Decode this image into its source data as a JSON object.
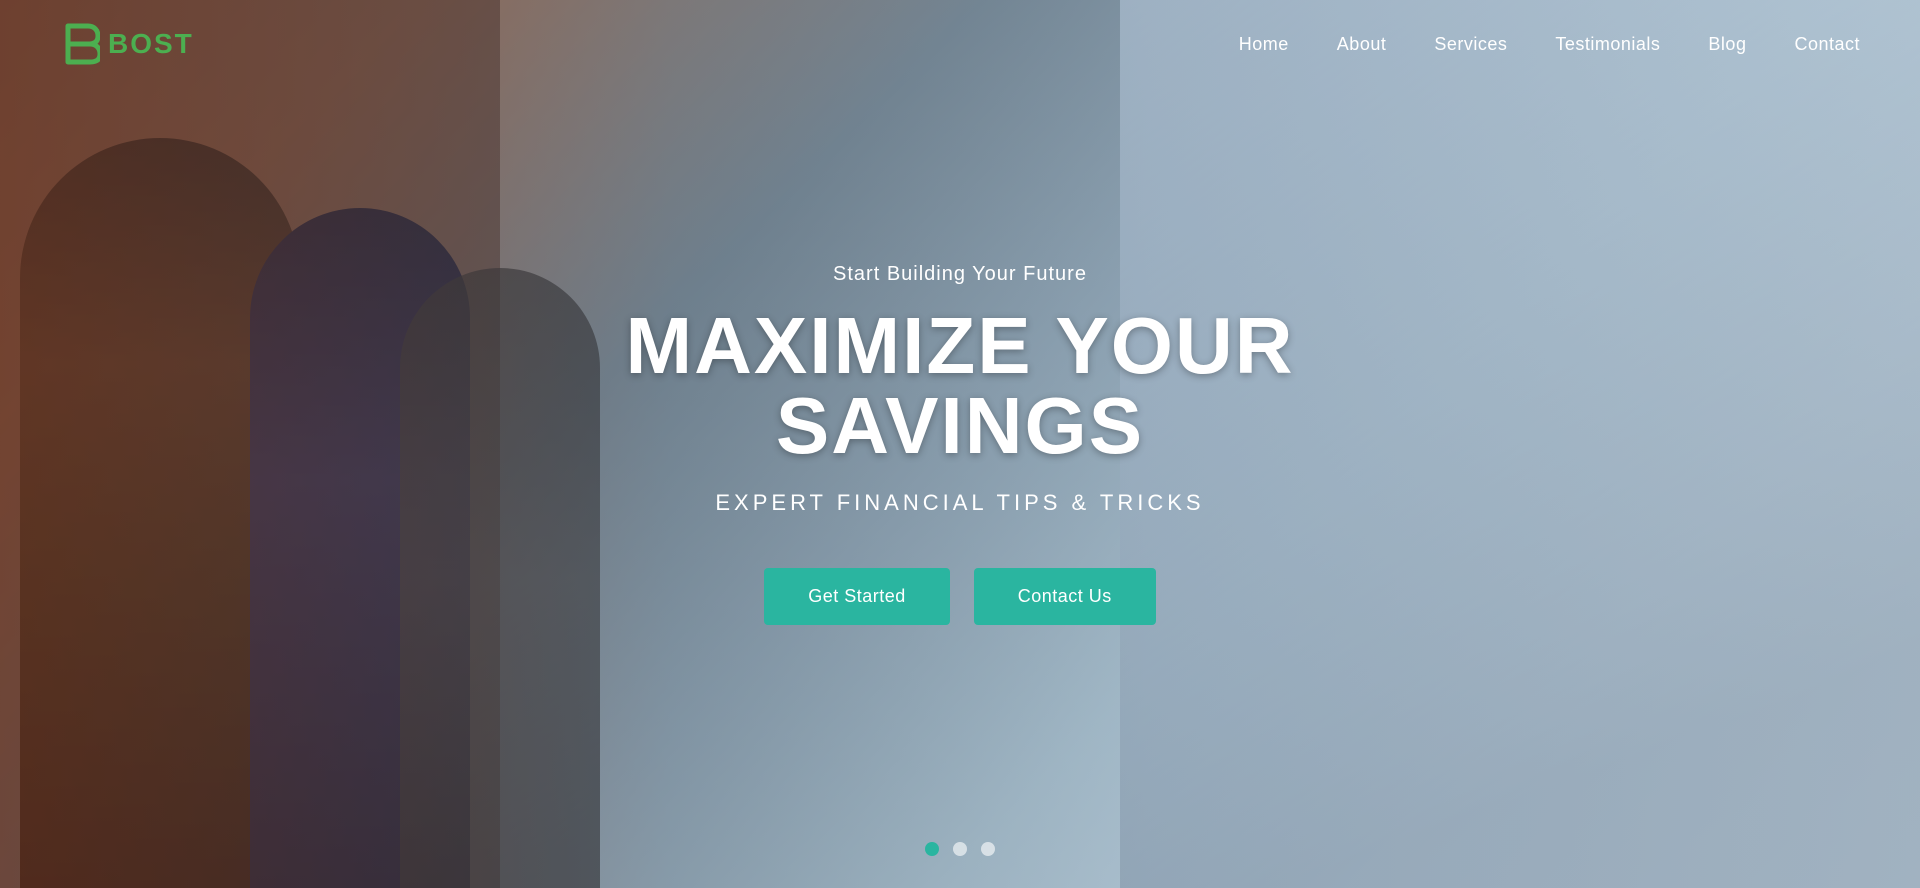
{
  "brand": {
    "name": "BOST",
    "logo_symbol": "₪",
    "color": "#4CAF50"
  },
  "nav": {
    "links": [
      {
        "label": "Home",
        "href": "#"
      },
      {
        "label": "About",
        "href": "#"
      },
      {
        "label": "Services",
        "href": "#"
      },
      {
        "label": "Testimonials",
        "href": "#"
      },
      {
        "label": "Blog",
        "href": "#"
      },
      {
        "label": "Contact",
        "href": "#"
      }
    ]
  },
  "hero": {
    "subtitle": "Start Building Your Future",
    "title": "MAXIMIZE YOUR SAVINGS",
    "tagline": "EXPERT FINANCIAL TIPS & TRICKS",
    "btn_primary": "Get Started",
    "btn_secondary": "Contact Us"
  },
  "carousel": {
    "dots": [
      {
        "state": "active"
      },
      {
        "state": "inactive"
      },
      {
        "state": "inactive"
      }
    ]
  }
}
